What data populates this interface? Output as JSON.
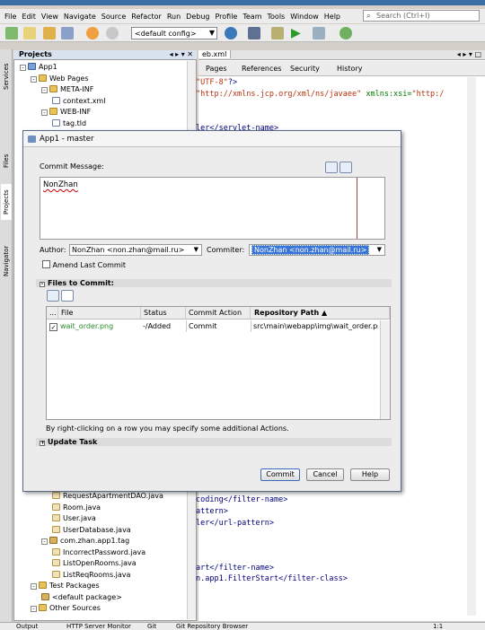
{
  "menu": [
    "File",
    "Edit",
    "View",
    "Navigate",
    "Source",
    "Refactor",
    "Run",
    "Debug",
    "Profile",
    "Team",
    "Tools",
    "Window",
    "Help"
  ],
  "search": {
    "placeholder": "Search (Ctrl+I)"
  },
  "toolbar": {
    "config": "<default config>"
  },
  "side_tabs": {
    "services": "Services",
    "files": "Files",
    "projects": "Projects",
    "navigator": "Navigator"
  },
  "projects": {
    "title": "Projects",
    "tree_top": [
      {
        "label": "App1",
        "type": "proj",
        "indent": 0,
        "toggle": "-"
      },
      {
        "label": "Web Pages",
        "type": "folder",
        "indent": 1,
        "toggle": "-"
      },
      {
        "label": "META-INF",
        "type": "folder",
        "indent": 2,
        "toggle": "-"
      },
      {
        "label": "context.xml",
        "type": "file",
        "indent": 3,
        "toggle": ""
      },
      {
        "label": "WEB-INF",
        "type": "folder",
        "indent": 2,
        "toggle": "-"
      },
      {
        "label": "tag.tld",
        "type": "file",
        "indent": 3,
        "toggle": ""
      }
    ],
    "tree_bottom": [
      {
        "label": "RequestApartmentDAO.java",
        "type": "java",
        "indent": 3,
        "toggle": ""
      },
      {
        "label": "Room.java",
        "type": "java",
        "indent": 3,
        "toggle": ""
      },
      {
        "label": "User.java",
        "type": "java",
        "indent": 3,
        "toggle": ""
      },
      {
        "label": "UserDatabase.java",
        "type": "java",
        "indent": 3,
        "toggle": ""
      },
      {
        "label": "com.zhan.app1.tag",
        "type": "pkg",
        "indent": 2,
        "toggle": "-"
      },
      {
        "label": "IncorrectPassword.java",
        "type": "java",
        "indent": 3,
        "toggle": ""
      },
      {
        "label": "ListOpenRooms.java",
        "type": "java",
        "indent": 3,
        "toggle": ""
      },
      {
        "label": "ListReqRooms.java",
        "type": "java",
        "indent": 3,
        "toggle": ""
      },
      {
        "label": "Test Packages",
        "type": "folder",
        "indent": 1,
        "toggle": "-"
      },
      {
        "label": "<default package>",
        "type": "pkg",
        "indent": 2,
        "toggle": ""
      },
      {
        "label": "Other Sources",
        "type": "folder",
        "indent": 1,
        "toggle": "-"
      }
    ]
  },
  "editor": {
    "tab": "eb.xml",
    "subtabs": [
      "Pages",
      "References",
      "Security",
      "History"
    ],
    "code_top": [
      {
        "parts": [
          [
            "str",
            "\"UTF-8\""
          ],
          [
            "tag",
            "?>"
          ]
        ]
      },
      {
        "parts": [
          [
            "str",
            "\"http://xmlns.jcp.org/xml/ns/javaee\""
          ],
          [
            "attr",
            " xmlns:xsi="
          ],
          [
            "str",
            "\"http:/"
          ]
        ]
      },
      {
        "parts": [
          [
            "tag",
            "ler</servlet-name>"
          ]
        ]
      }
    ],
    "code_bottom": [
      {
        "parts": [
          [
            "tag",
            "coding</filter-name>"
          ]
        ]
      },
      {
        "parts": [
          [
            "tag",
            "attern>"
          ]
        ]
      },
      {
        "parts": [
          [
            "tag",
            "ler</url-pattern>"
          ]
        ]
      },
      {
        "parts": [
          [
            "tag",
            "art</filter-name>"
          ]
        ]
      },
      {
        "parts": [
          [
            "tag",
            "n.app1.FilterStart</filter-class>"
          ]
        ]
      }
    ]
  },
  "statusbar": {
    "output": "Output",
    "http": "HTTP Server Monitor",
    "git": "Git",
    "git_repo": "Git Repository Browser",
    "position": "1:1"
  },
  "dialog": {
    "title": "App1 - master",
    "commit_message_label": "Commit Message:",
    "commit_message": "NonZhan",
    "author_label": "Author:",
    "author": "NonZhan <non.zhan@mail.ru>",
    "committer_label": "Commiter:",
    "committer": "NonZhan <non.zhan@mail.ru>",
    "amend_label": "Amend Last Commit",
    "files_section": "Files to Commit:",
    "columns": [
      "...",
      "File",
      "Status",
      "Commit Action",
      "Repository Path"
    ],
    "rows": [
      {
        "file": "wait_order.png",
        "status": "-/Added",
        "action": "Commit",
        "path": "src\\main\\webapp\\img\\wait_order.png"
      }
    ],
    "hint": "By right-clicking on a row you may specify some additional Actions.",
    "update_section": "Update Task",
    "buttons": {
      "commit": "Commit",
      "cancel": "Cancel",
      "help": "Help"
    }
  }
}
